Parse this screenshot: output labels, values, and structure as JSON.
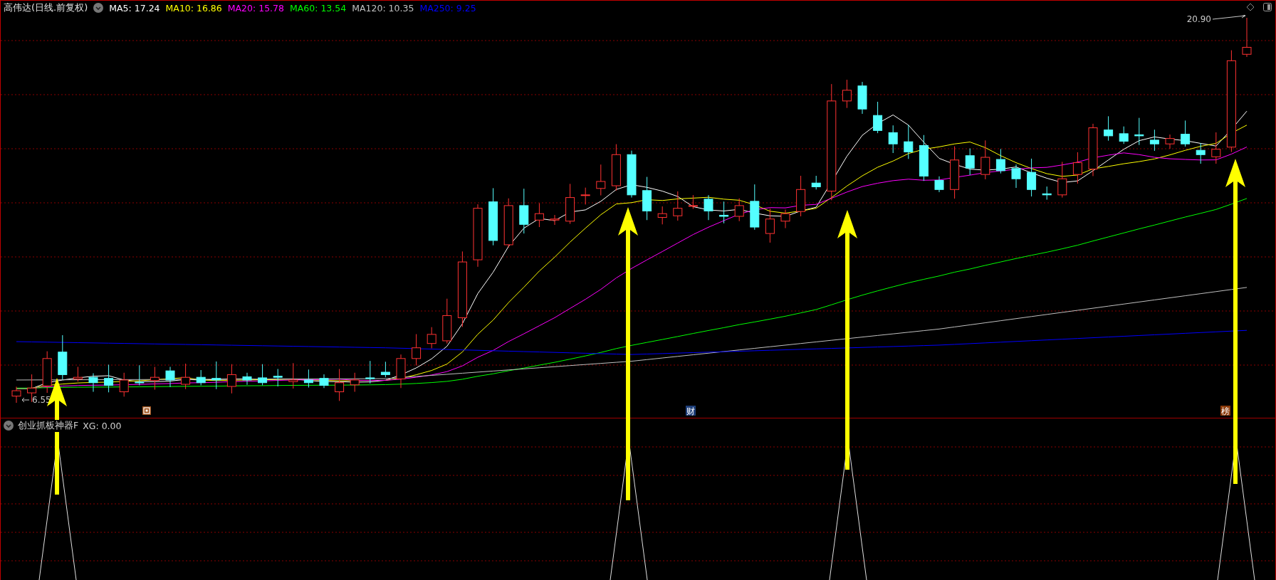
{
  "chart": {
    "title": "高伟达(日线.前复权)",
    "indicators": [
      {
        "label": "MA5: 17.24",
        "color": "#ffffff"
      },
      {
        "label": "MA10: 16.86",
        "color": "#ffff00"
      },
      {
        "label": "MA20: 15.78",
        "color": "#ff00ff"
      },
      {
        "label": "MA60: 13.54",
        "color": "#00ff00"
      },
      {
        "label": "MA120: 10.35",
        "color": "#c0c0c0"
      },
      {
        "label": "MA250: 9.25",
        "color": "#0000ff"
      }
    ],
    "high_label": "20.90",
    "low_label": "6.55",
    "markers": [
      {
        "kind": "icon",
        "color": "#a0521a"
      },
      {
        "kind": "text",
        "label": "财",
        "color": "#1e3f7a"
      },
      {
        "kind": "text",
        "label": "榜",
        "color": "#8b3a0a"
      }
    ]
  },
  "indicator_panel": {
    "title": "创业抓板神器F",
    "reading": "XG: 0.00"
  }
}
